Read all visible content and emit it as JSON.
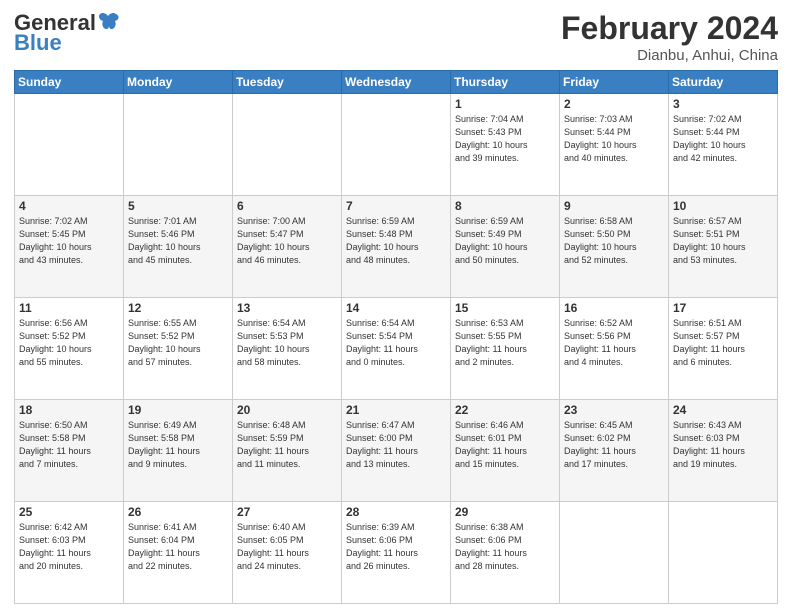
{
  "logo": {
    "text_general": "General",
    "text_blue": "Blue"
  },
  "title": {
    "month_year": "February 2024",
    "location": "Dianbu, Anhui, China"
  },
  "days_of_week": [
    "Sunday",
    "Monday",
    "Tuesday",
    "Wednesday",
    "Thursday",
    "Friday",
    "Saturday"
  ],
  "weeks": [
    [
      {
        "day": "",
        "info": ""
      },
      {
        "day": "",
        "info": ""
      },
      {
        "day": "",
        "info": ""
      },
      {
        "day": "",
        "info": ""
      },
      {
        "day": "1",
        "info": "Sunrise: 7:04 AM\nSunset: 5:43 PM\nDaylight: 10 hours\nand 39 minutes."
      },
      {
        "day": "2",
        "info": "Sunrise: 7:03 AM\nSunset: 5:44 PM\nDaylight: 10 hours\nand 40 minutes."
      },
      {
        "day": "3",
        "info": "Sunrise: 7:02 AM\nSunset: 5:44 PM\nDaylight: 10 hours\nand 42 minutes."
      }
    ],
    [
      {
        "day": "4",
        "info": "Sunrise: 7:02 AM\nSunset: 5:45 PM\nDaylight: 10 hours\nand 43 minutes."
      },
      {
        "day": "5",
        "info": "Sunrise: 7:01 AM\nSunset: 5:46 PM\nDaylight: 10 hours\nand 45 minutes."
      },
      {
        "day": "6",
        "info": "Sunrise: 7:00 AM\nSunset: 5:47 PM\nDaylight: 10 hours\nand 46 minutes."
      },
      {
        "day": "7",
        "info": "Sunrise: 6:59 AM\nSunset: 5:48 PM\nDaylight: 10 hours\nand 48 minutes."
      },
      {
        "day": "8",
        "info": "Sunrise: 6:59 AM\nSunset: 5:49 PM\nDaylight: 10 hours\nand 50 minutes."
      },
      {
        "day": "9",
        "info": "Sunrise: 6:58 AM\nSunset: 5:50 PM\nDaylight: 10 hours\nand 52 minutes."
      },
      {
        "day": "10",
        "info": "Sunrise: 6:57 AM\nSunset: 5:51 PM\nDaylight: 10 hours\nand 53 minutes."
      }
    ],
    [
      {
        "day": "11",
        "info": "Sunrise: 6:56 AM\nSunset: 5:52 PM\nDaylight: 10 hours\nand 55 minutes."
      },
      {
        "day": "12",
        "info": "Sunrise: 6:55 AM\nSunset: 5:52 PM\nDaylight: 10 hours\nand 57 minutes."
      },
      {
        "day": "13",
        "info": "Sunrise: 6:54 AM\nSunset: 5:53 PM\nDaylight: 10 hours\nand 58 minutes."
      },
      {
        "day": "14",
        "info": "Sunrise: 6:54 AM\nSunset: 5:54 PM\nDaylight: 11 hours\nand 0 minutes."
      },
      {
        "day": "15",
        "info": "Sunrise: 6:53 AM\nSunset: 5:55 PM\nDaylight: 11 hours\nand 2 minutes."
      },
      {
        "day": "16",
        "info": "Sunrise: 6:52 AM\nSunset: 5:56 PM\nDaylight: 11 hours\nand 4 minutes."
      },
      {
        "day": "17",
        "info": "Sunrise: 6:51 AM\nSunset: 5:57 PM\nDaylight: 11 hours\nand 6 minutes."
      }
    ],
    [
      {
        "day": "18",
        "info": "Sunrise: 6:50 AM\nSunset: 5:58 PM\nDaylight: 11 hours\nand 7 minutes."
      },
      {
        "day": "19",
        "info": "Sunrise: 6:49 AM\nSunset: 5:58 PM\nDaylight: 11 hours\nand 9 minutes."
      },
      {
        "day": "20",
        "info": "Sunrise: 6:48 AM\nSunset: 5:59 PM\nDaylight: 11 hours\nand 11 minutes."
      },
      {
        "day": "21",
        "info": "Sunrise: 6:47 AM\nSunset: 6:00 PM\nDaylight: 11 hours\nand 13 minutes."
      },
      {
        "day": "22",
        "info": "Sunrise: 6:46 AM\nSunset: 6:01 PM\nDaylight: 11 hours\nand 15 minutes."
      },
      {
        "day": "23",
        "info": "Sunrise: 6:45 AM\nSunset: 6:02 PM\nDaylight: 11 hours\nand 17 minutes."
      },
      {
        "day": "24",
        "info": "Sunrise: 6:43 AM\nSunset: 6:03 PM\nDaylight: 11 hours\nand 19 minutes."
      }
    ],
    [
      {
        "day": "25",
        "info": "Sunrise: 6:42 AM\nSunset: 6:03 PM\nDaylight: 11 hours\nand 20 minutes."
      },
      {
        "day": "26",
        "info": "Sunrise: 6:41 AM\nSunset: 6:04 PM\nDaylight: 11 hours\nand 22 minutes."
      },
      {
        "day": "27",
        "info": "Sunrise: 6:40 AM\nSunset: 6:05 PM\nDaylight: 11 hours\nand 24 minutes."
      },
      {
        "day": "28",
        "info": "Sunrise: 6:39 AM\nSunset: 6:06 PM\nDaylight: 11 hours\nand 26 minutes."
      },
      {
        "day": "29",
        "info": "Sunrise: 6:38 AM\nSunset: 6:06 PM\nDaylight: 11 hours\nand 28 minutes."
      },
      {
        "day": "",
        "info": ""
      },
      {
        "day": "",
        "info": ""
      }
    ]
  ]
}
